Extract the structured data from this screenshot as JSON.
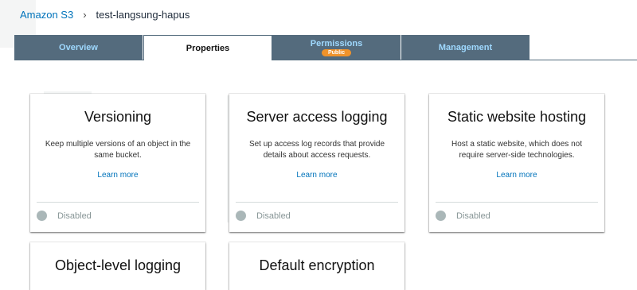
{
  "breadcrumb": {
    "root": "Amazon S3",
    "separator": "›",
    "current": "test-langsung-hapus"
  },
  "tabs": [
    {
      "label": "Overview",
      "active": false,
      "badge": ""
    },
    {
      "label": "Properties",
      "active": true,
      "badge": ""
    },
    {
      "label": "Permissions",
      "active": false,
      "badge": "Public"
    },
    {
      "label": "Management",
      "active": false,
      "badge": ""
    }
  ],
  "cards": [
    {
      "title": "Versioning",
      "description": "Keep multiple versions of an object in the same bucket.",
      "link": "Learn more",
      "status": "Disabled"
    },
    {
      "title": "Server access logging",
      "description": "Set up access log records that provide details about access requests.",
      "link": "Learn more",
      "status": "Disabled"
    },
    {
      "title": "Static website hosting",
      "description": "Host a static website, which does not require server-side technologies.",
      "link": "Learn more",
      "status": "Disabled"
    },
    {
      "title": "Object-level logging"
    },
    {
      "title": "Default encryption"
    }
  ],
  "colors": {
    "tab_bg": "#546b7d",
    "tab_text": "#9fd9ff",
    "badge_bg": "#f0932b",
    "link": "#0073bb",
    "status_dot": "#aab7b8"
  }
}
